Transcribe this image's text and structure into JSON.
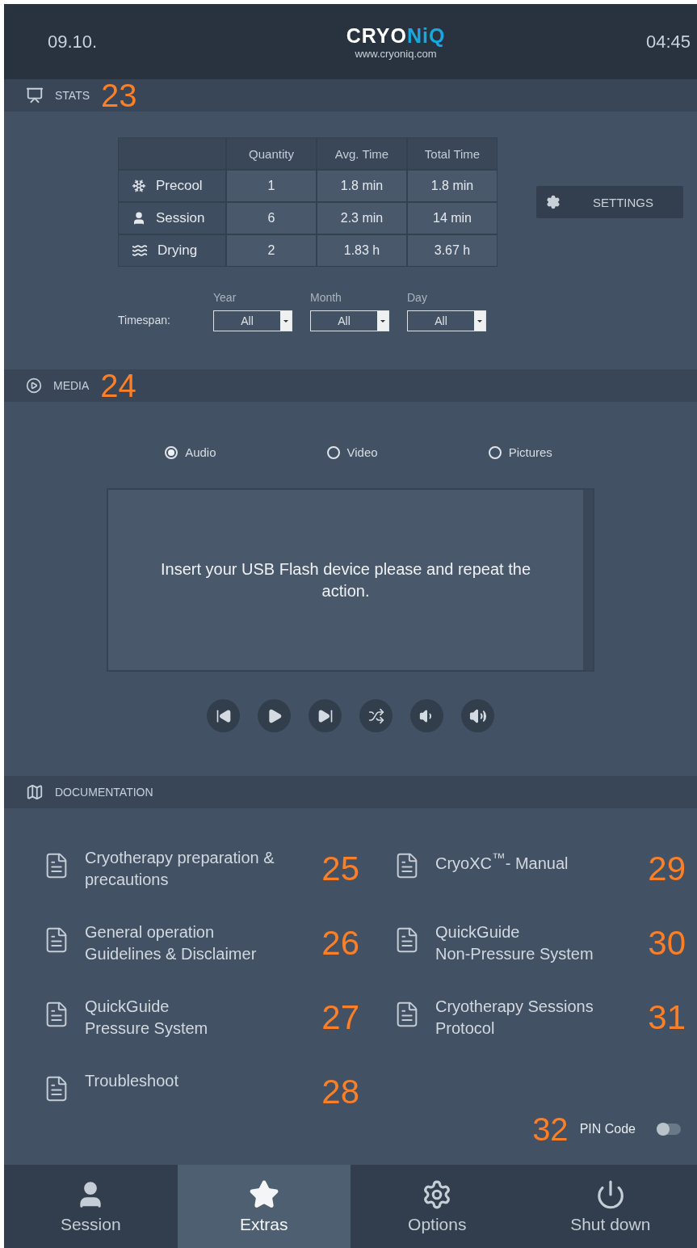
{
  "header": {
    "date": "09.10.",
    "logo": {
      "part_1": "CRYO",
      "part_2": "NiQ",
      "url": "www.cryoniq.com"
    },
    "time": "04:45"
  },
  "stats": {
    "title": "STATS",
    "callout": "23",
    "table": {
      "columns": [
        "Quantity",
        "Avg. Time",
        "Total Time"
      ],
      "rows": [
        {
          "kind": "snowflake",
          "label": "Precool",
          "cells": [
            "1",
            "1.8 min",
            "1.8 min"
          ]
        },
        {
          "kind": "person",
          "label": "Session",
          "cells": [
            "6",
            "2.3 min",
            "14 min"
          ]
        },
        {
          "kind": "waves",
          "label": "Drying",
          "cells": [
            "2",
            "1.83 h",
            "3.67 h"
          ]
        }
      ]
    },
    "settings_button": "SETTINGS",
    "timespan": {
      "label": "Timespan:",
      "selects": [
        {
          "label": "Year",
          "value": "All"
        },
        {
          "label": "Month",
          "value": "All"
        },
        {
          "label": "Day",
          "value": "All"
        }
      ]
    }
  },
  "media": {
    "title": "MEDIA",
    "callout": "24",
    "options": [
      {
        "label": "Audio",
        "selected": true
      },
      {
        "label": "Video",
        "selected": false
      },
      {
        "label": "Pictures",
        "selected": false
      }
    ],
    "message": "Insert your USB Flash device please and repeat the action.",
    "controls": [
      {
        "kind": "previous"
      },
      {
        "kind": "play"
      },
      {
        "kind": "next"
      },
      {
        "kind": "shuffle"
      },
      {
        "kind": "volume-down"
      },
      {
        "kind": "volume-up"
      }
    ]
  },
  "documentation": {
    "title": "DOCUMENTATION",
    "columns": [
      [
        {
          "title": "Cryotherapy preparation &\nprecautions",
          "callout": "25"
        },
        {
          "title": "General operation\nGuidelines & Disclaimer",
          "callout": "26"
        },
        {
          "title": "QuickGuide\nPressure System",
          "callout": "27"
        },
        {
          "title": "Troubleshoot",
          "callout": "28"
        }
      ],
      [
        {
          "title": "CryoXC$^{™}$- Manual",
          "callout": "29"
        },
        {
          "title": "QuickGuide\nNon-Pressure System",
          "callout": "30"
        },
        {
          "title": "Cryotherapy Sessions\nProtocol",
          "callout": "31"
        }
      ]
    ],
    "pin_code": {
      "callout": "32",
      "label": "PIN Code",
      "on": false
    }
  },
  "nav": [
    {
      "kind": "person",
      "label": "Session",
      "selected": false
    },
    {
      "kind": "star",
      "label": "Extras",
      "selected": true
    },
    {
      "kind": "gear",
      "label": "Options",
      "selected": false
    },
    {
      "kind": "power",
      "label": "Shut down",
      "selected": false
    }
  ]
}
